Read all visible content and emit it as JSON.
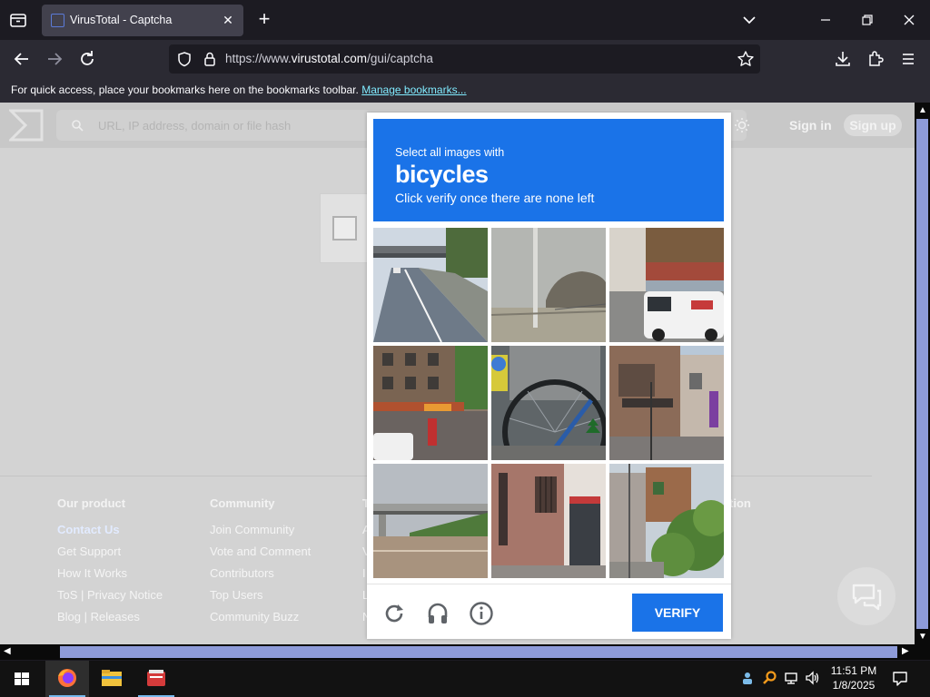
{
  "browser": {
    "tab_title": "VirusTotal - Captcha",
    "url_host_prefix": "https://www.",
    "url_host": "virustotal.com",
    "url_path": "/gui/captcha",
    "bookmarks_text": "For quick access, place your bookmarks here on the bookmarks toolbar.",
    "bookmarks_link": "Manage bookmarks..."
  },
  "page": {
    "search_placeholder": "URL, IP address, domain or file hash",
    "sign_in": "Sign in",
    "sign_up": "Sign up",
    "footer": {
      "our_product": {
        "heading": "Our product",
        "items": [
          "Contact Us",
          "Get Support",
          "How It Works",
          "ToS | Privacy Notice",
          "Blog | Releases"
        ]
      },
      "community": {
        "heading": "Community",
        "items": [
          "Join Community",
          "Vote and Comment",
          "Contributors",
          "Top Users",
          "Community Buzz"
        ]
      },
      "third_heading_partial": "T",
      "third_items_partial": [
        "A",
        "V",
        "I",
        "L",
        "N"
      ],
      "fourth_heading_partial": "tion"
    }
  },
  "captcha": {
    "line1": "Select all images with",
    "target": "bicycles",
    "line3": "Click verify once there are none left",
    "verify_label": "VERIFY",
    "tiles": [
      "road-overpass",
      "foggy-shore-pole",
      "street-white-van",
      "brick-building-shops",
      "bicycle-wheel",
      "japanese-house-street",
      "highway-overpass",
      "pink-wall-doorway",
      "street-trees-bush"
    ]
  },
  "taskbar": {
    "time": "11:51 PM",
    "date": "1/8/2025"
  },
  "colors": {
    "accent_blue": "#1a73e8",
    "chrome_dark": "#1c1b22",
    "link_cyan": "#80ebff",
    "scroll_thumb": "#8e9bd9"
  }
}
